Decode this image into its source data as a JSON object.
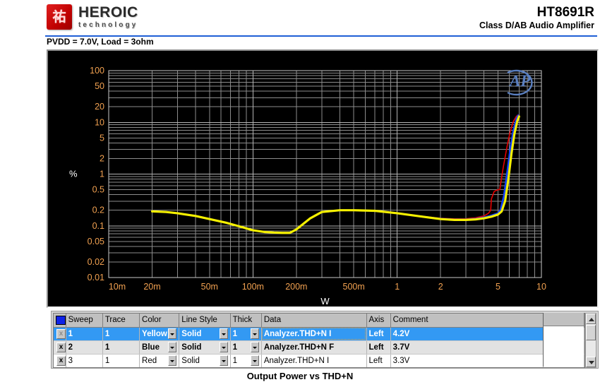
{
  "header": {
    "logo_title": "HEROIC",
    "logo_sub": "technology",
    "logo_seal_glyph": "祐",
    "part_number": "HT8691R",
    "part_desc": "Class D/AB Audio Amplifier",
    "accent_color": "#1f5fd6"
  },
  "condition": "PVDD = 7.0V, Load = 3ohm",
  "caption": "Output Power vs THD+N",
  "plot": {
    "watermark": "AP",
    "background": "#000000",
    "grid_color": "#8c8c8c",
    "tick_label_color": "#f0a050"
  },
  "chart_data": {
    "type": "line",
    "title": "Output Power vs THD+N",
    "subtitle": "PVDD = 7.0V, Load = 3ohm",
    "xlabel": "W",
    "ylabel": "%",
    "xscale": "log",
    "yscale": "log",
    "xlim": [
      0.01,
      10
    ],
    "ylim": [
      0.01,
      100
    ],
    "grid": true,
    "legend": "table",
    "xticks": [
      0.01,
      0.02,
      0.05,
      0.1,
      0.2,
      0.5,
      1,
      2,
      5,
      10
    ],
    "xticklabels": [
      "10m",
      "20m",
      "50m",
      "100m",
      "200m",
      "500m",
      "1",
      "2",
      "5",
      "10"
    ],
    "yticks": [
      0.01,
      0.02,
      0.05,
      0.1,
      0.2,
      0.5,
      1,
      2,
      5,
      10,
      20,
      50,
      100
    ],
    "yticklabels": [
      "0.01",
      "0.02",
      "0.05",
      "0.1",
      "0.2",
      "0.5",
      "1",
      "2",
      "5",
      "10",
      "20",
      "50",
      "100"
    ],
    "series": [
      {
        "name": "4.2V",
        "color": "#f5f000",
        "x": [
          0.02,
          0.025,
          0.03,
          0.04,
          0.05,
          0.065,
          0.08,
          0.1,
          0.12,
          0.14,
          0.16,
          0.18,
          0.2,
          0.25,
          0.3,
          0.4,
          0.5,
          0.7,
          1.0,
          1.5,
          2.0,
          2.5,
          3.0,
          3.5,
          4.0,
          4.5,
          5.0,
          5.3,
          5.6,
          5.9,
          6.2,
          6.5,
          6.8,
          7.0
        ],
        "y": [
          0.19,
          0.185,
          0.175,
          0.155,
          0.135,
          0.115,
          0.098,
          0.082,
          0.076,
          0.074,
          0.073,
          0.073,
          0.085,
          0.14,
          0.185,
          0.2,
          0.2,
          0.195,
          0.175,
          0.15,
          0.135,
          0.13,
          0.13,
          0.133,
          0.14,
          0.15,
          0.165,
          0.19,
          0.3,
          0.8,
          2.5,
          6.0,
          10.5,
          13.0
        ]
      },
      {
        "name": "3.7V",
        "color": "#1040ff",
        "x": [
          0.02,
          0.025,
          0.03,
          0.04,
          0.05,
          0.065,
          0.08,
          0.1,
          0.12,
          0.14,
          0.16,
          0.18,
          0.2,
          0.25,
          0.3,
          0.4,
          0.5,
          0.7,
          1.0,
          1.5,
          2.0,
          2.5,
          3.0,
          3.5,
          4.0,
          4.5,
          5.0,
          5.2,
          5.5,
          5.8,
          6.1,
          6.4,
          6.7,
          6.9
        ],
        "y": [
          0.19,
          0.185,
          0.175,
          0.155,
          0.135,
          0.115,
          0.098,
          0.082,
          0.076,
          0.074,
          0.073,
          0.073,
          0.085,
          0.14,
          0.185,
          0.2,
          0.2,
          0.195,
          0.175,
          0.15,
          0.137,
          0.132,
          0.132,
          0.136,
          0.145,
          0.158,
          0.175,
          0.2,
          0.38,
          1.1,
          3.2,
          7.0,
          11.5,
          13.6
        ]
      },
      {
        "name": "3.3V",
        "color": "#e60000",
        "x": [
          0.02,
          0.025,
          0.03,
          0.04,
          0.05,
          0.065,
          0.08,
          0.1,
          0.12,
          0.14,
          0.16,
          0.18,
          0.2,
          0.25,
          0.3,
          0.4,
          0.5,
          0.7,
          1.0,
          1.5,
          2.0,
          2.5,
          3.0,
          3.5,
          4.0,
          4.3,
          4.45,
          4.5,
          4.7,
          5.0,
          5.15,
          5.2,
          5.45,
          5.8,
          6.1,
          6.4,
          6.7,
          6.9
        ],
        "y": [
          0.19,
          0.185,
          0.175,
          0.155,
          0.135,
          0.115,
          0.098,
          0.082,
          0.076,
          0.074,
          0.073,
          0.073,
          0.085,
          0.14,
          0.185,
          0.2,
          0.2,
          0.195,
          0.175,
          0.152,
          0.14,
          0.136,
          0.137,
          0.143,
          0.155,
          0.175,
          0.2,
          0.33,
          0.46,
          0.5,
          0.5,
          0.62,
          1.4,
          3.6,
          7.0,
          10.5,
          13.0,
          14.0
        ]
      }
    ]
  },
  "table": {
    "columns": [
      "",
      "Sweep",
      "Trace",
      "Color",
      "Line Style",
      "Thick",
      "Data",
      "Axis",
      "Comment",
      ""
    ],
    "rows": [
      {
        "button": "x",
        "sweep": "1",
        "trace": "1",
        "color": "Yellow",
        "line_style": "Solid",
        "thick": "1",
        "data": "Analyzer.THD+N I",
        "axis": "Left",
        "comment": "4.2V",
        "selected": true
      },
      {
        "button": "x",
        "sweep": "2",
        "trace": "1",
        "color": "Blue",
        "line_style": "Solid",
        "thick": "1",
        "data": "Analyzer.THD+N F",
        "axis": "Left",
        "comment": "3.7V",
        "selected": false
      },
      {
        "button": "x",
        "sweep": "3",
        "trace": "1",
        "color": "Red",
        "line_style": "Solid",
        "thick": "1",
        "data": "Analyzer.THD+N I",
        "axis": "Left",
        "comment": "3.3V",
        "selected": false
      }
    ]
  }
}
